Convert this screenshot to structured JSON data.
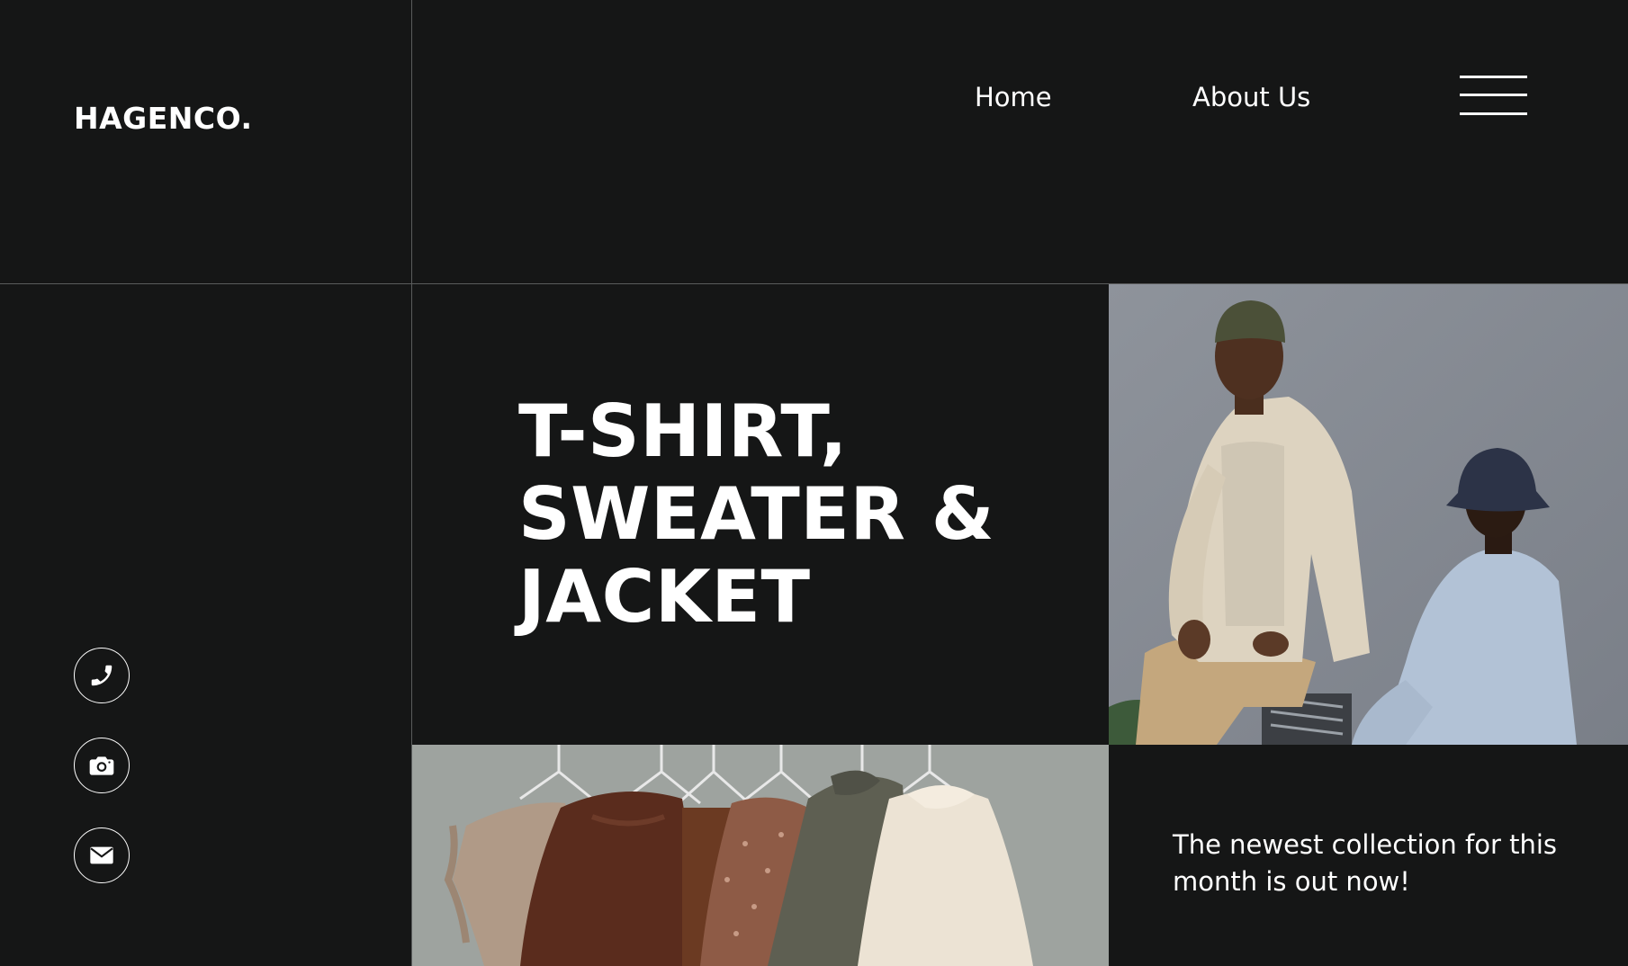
{
  "brand": {
    "logo": "HAGENCO."
  },
  "nav": {
    "items": [
      {
        "label": "Home"
      },
      {
        "label": "About Us"
      }
    ],
    "menu_icon": "hamburger-menu-icon"
  },
  "hero": {
    "title_lines": [
      "T-SHIRT,",
      "SWEATER &",
      "JACKET"
    ]
  },
  "images": {
    "people_photo": "two-models-photo",
    "clothes_photo": "clothes-on-hangers-photo"
  },
  "tagline": "The newest collection for this month is out now!",
  "social": [
    {
      "icon": "phone-icon"
    },
    {
      "icon": "camera-icon"
    },
    {
      "icon": "mail-icon"
    }
  ],
  "colors": {
    "background": "#151616",
    "text": "#ffffff",
    "divider": "#5a5c5c",
    "photo_backdrop": "#858a92"
  }
}
